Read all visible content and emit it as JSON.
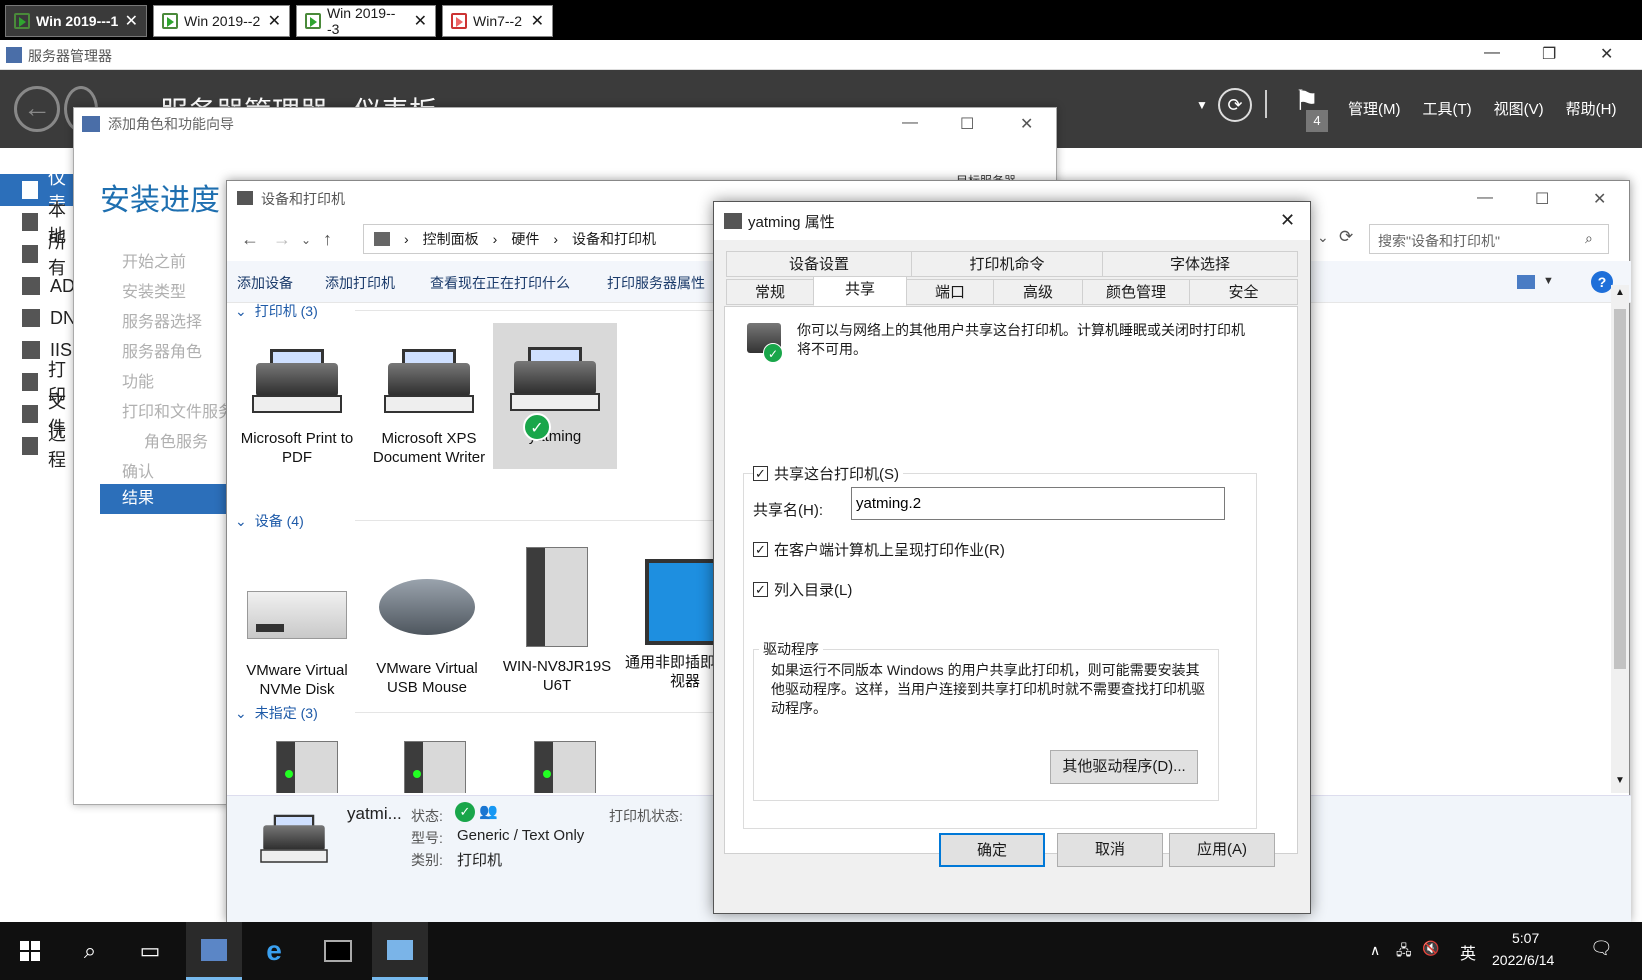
{
  "vm_tabs": [
    "Win 2019---1",
    "Win 2019--2",
    "Win 2019---3",
    "Win7--2"
  ],
  "server_manager": {
    "title": "服务器管理器",
    "header_title": "服务器管理器 · 仪表板",
    "notification_count": "4",
    "menus": [
      "管理(M)",
      "工具(T)",
      "视图(V)",
      "帮助(H)"
    ],
    "sidebar": [
      "仪表",
      "本地",
      "所有",
      "AD",
      "DN",
      "IIS",
      "打印",
      "文件",
      "远程"
    ]
  },
  "wizard": {
    "title": "添加角色和功能向导",
    "heading": "安装进度",
    "target_label": "目标服务器",
    "steps": [
      "开始之前",
      "安装类型",
      "服务器选择",
      "服务器角色",
      "功能",
      "打印和文件服务",
      "角色服务",
      "确认",
      "结果"
    ]
  },
  "devices_window": {
    "title": "设备和打印机",
    "breadcrumb": [
      "控制面板",
      "硬件",
      "设备和打印机"
    ],
    "search_placeholder": "搜索\"设备和打印机\"",
    "commands": [
      "添加设备",
      "添加打印机",
      "查看现在正在打印什么",
      "打印服务器属性"
    ],
    "groups": {
      "printers": "打印机 (3)",
      "devices": "设备 (4)",
      "unspecified": "未指定 (3)"
    },
    "printers": [
      "Microsoft Print to PDF",
      "Microsoft XPS Document Writer",
      "yatming"
    ],
    "devices": [
      "VMware Virtual NVMe Disk",
      "VMware Virtual USB Mouse",
      "WIN-NV8JR19S U6T",
      "通用非即插即用监视器"
    ],
    "details": {
      "name": "yatmi...",
      "status_label": "状态:",
      "model_label": "型号:",
      "model_value": "Generic / Text Only",
      "category_label": "类别:",
      "category_value": "打印机",
      "printer_status_label": "打印机状态:"
    }
  },
  "properties_dialog": {
    "title": "yatming 属性",
    "tabs_top": [
      "设备设置",
      "打印机命令",
      "字体选择"
    ],
    "tabs_bottom": [
      "常规",
      "共享",
      "端口",
      "高级",
      "颜色管理",
      "安全"
    ],
    "selected_tab": "共享",
    "info_text": "你可以与网络上的其他用户共享这台打印机。计算机睡眠或关闭时打印机将不可用。",
    "share_checkbox": "共享这台打印机(S)",
    "share_name_label": "共享名(H):",
    "share_name_value": "yatming.2",
    "render_checkbox": "在客户端计算机上呈现打印作业(R)",
    "list_checkbox": "列入目录(L)",
    "driver_group_label": "驱动程序",
    "driver_text": "如果运行不同版本 Windows 的用户共享此打印机，则可能需要安装其他驱动程序。这样，当用户连接到共享打印机时就不需要查找打印机驱动程序。",
    "other_drivers_button": "其他驱动程序(D)...",
    "ok_button": "确定",
    "cancel_button": "取消",
    "apply_button": "应用(A)"
  },
  "taskbar": {
    "ime": "英",
    "time": "5:07",
    "date": "2022/6/14"
  }
}
